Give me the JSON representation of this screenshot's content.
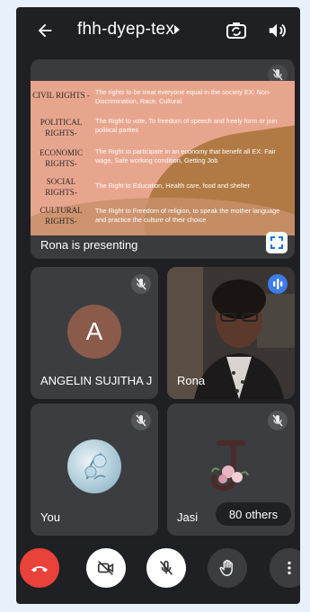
{
  "header": {
    "title": "fhh-dyep-tex"
  },
  "presentation": {
    "label": "Rona is presenting",
    "slide": [
      {
        "term": "CIVIL RIGHTS -",
        "definition": "The rights to be treat everyone equal in the society EX: Non-Discrimination, Race, Cultural"
      },
      {
        "term": "POLITICAL RIGHTS-",
        "definition": "The Right to vote, To freedom of speech and freely form or join political parties"
      },
      {
        "term": "ECONOMIC RIGHTS-",
        "definition": "The Right to participate in an economy that benefit all EX: Fair wage, Safe working condition, Getting Job"
      },
      {
        "term": "SOCIAL RIGHTS-",
        "definition": "The Right to Education, Health care, food and shelter"
      },
      {
        "term": "CULTURAL RIGHTS-",
        "definition": "The Right to Freedom of religion, to speak the mother language and practice the culture of their choice"
      }
    ]
  },
  "participants": {
    "angelin": {
      "name": "ANGELIN SUJITHA J",
      "initial": "A"
    },
    "rona": {
      "name": "Rona"
    },
    "you": {
      "name": "You"
    },
    "jasi": {
      "name": "Jasi",
      "others": "80 others"
    }
  },
  "colors": {
    "end_call": "#e9423a",
    "speaking": "#3d7ce8",
    "background": "#1f2023"
  }
}
